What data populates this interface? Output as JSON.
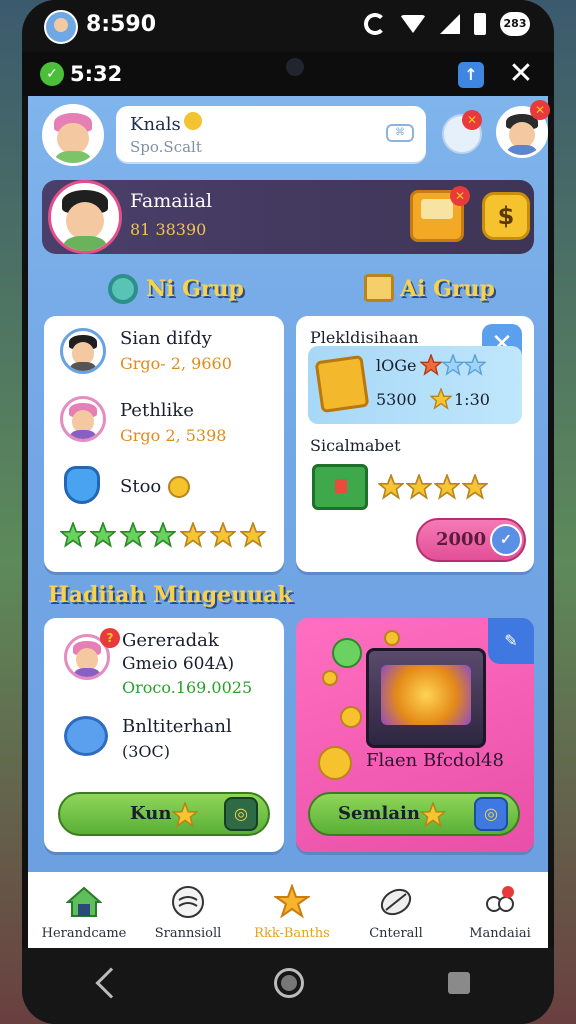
{
  "status_bar": {
    "time": "8:590",
    "badge": "283"
  },
  "app_bar": {
    "time": "5:32"
  },
  "search": {
    "name": "Knals",
    "placeholder": "Spo.Scalt"
  },
  "profile": {
    "name": "Famaiial",
    "score": "81 38390",
    "coin_symbol": "$"
  },
  "sections": {
    "left_title": "Ni Grup",
    "right_title": "Ai Grup",
    "rewards_title": "Hadiiah Mingeuuak"
  },
  "left_card": {
    "rows": [
      {
        "name": "Sian difdy",
        "sub": "Grgo- 2, 9660"
      },
      {
        "name": "Pethlike",
        "sub": "Grgo 2, 5398"
      },
      {
        "name": "Stoo"
      }
    ],
    "stars_total": 7
  },
  "right_card": {
    "title": "Plekldisihaan",
    "reward_line1": "lOGe",
    "reward_line2_value": "5300",
    "reward_line2_time": "1:30",
    "item_title": "Sicalmabet",
    "button_value": "2000"
  },
  "bottom_left_card": {
    "rows": [
      {
        "name": "Gereradak",
        "sub": "Gmeio 604A)",
        "sub2": "Oroco.169.0025"
      },
      {
        "name": "Bnltiterhanl",
        "sub": "(3OC)"
      }
    ],
    "button": "Kun"
  },
  "bottom_right_card": {
    "label": "Flaen Bfcdol48",
    "button": "Semlain"
  },
  "bottom_nav": [
    {
      "label": "Herandcame",
      "icon": "home-icon"
    },
    {
      "label": "Srannsioll",
      "icon": "chat-icon"
    },
    {
      "label": "Rkk-Banths",
      "icon": "star-badge-icon",
      "active": true
    },
    {
      "label": "Cnterall",
      "icon": "leaf-icon"
    },
    {
      "label": "Mandaiai",
      "icon": "people-icon"
    }
  ],
  "colors": {
    "accent_gold": "#f8d24a",
    "pink": "#ff6fc1",
    "green": "#59b035",
    "panel_blue": "#7fb4ec"
  }
}
